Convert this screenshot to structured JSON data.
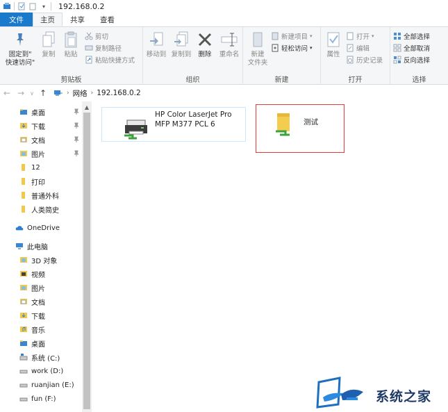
{
  "window": {
    "title": "192.168.0.2"
  },
  "tabs": [
    {
      "label": "文件"
    },
    {
      "label": "主页"
    },
    {
      "label": "共享"
    },
    {
      "label": "查看"
    }
  ],
  "ribbon": {
    "clipboard": {
      "label": "剪贴板",
      "pin_quick_access": "固定到\"\n快速访问\"",
      "pin_line1": "固定到\"",
      "pin_line2": "快速访问\"",
      "copy": "复制",
      "paste": "粘贴",
      "cut": "剪切",
      "copy_path": "复制路径",
      "paste_shortcut": "粘贴快捷方式"
    },
    "organize": {
      "label": "组织",
      "move_to": "移动到",
      "copy_to": "复制到",
      "delete": "删除",
      "rename": "重命名"
    },
    "new": {
      "label": "新建",
      "new_folder_line1": "新建",
      "new_folder_line2": "文件夹",
      "new_item": "新建项目",
      "easy_access": "轻松访问"
    },
    "open": {
      "label": "打开",
      "properties": "属性",
      "open": "打开",
      "edit": "编辑",
      "history": "历史记录"
    },
    "select": {
      "label": "选择",
      "select_all": "全部选择",
      "select_none": "全部取消",
      "invert": "反向选择"
    }
  },
  "address": {
    "root": "网络",
    "host": "192.168.0.2"
  },
  "nav": {
    "quick_access": [
      {
        "label": "桌面",
        "icon": "desktop-folder-icon",
        "pinned": true
      },
      {
        "label": "下载",
        "icon": "download-folder-icon",
        "pinned": true
      },
      {
        "label": "文档",
        "icon": "documents-folder-icon",
        "pinned": true
      },
      {
        "label": "图片",
        "icon": "pictures-folder-icon",
        "pinned": true
      },
      {
        "label": "12",
        "icon": "folder-icon",
        "pinned": false
      },
      {
        "label": "打印",
        "icon": "folder-icon",
        "pinned": false
      },
      {
        "label": "普通外科",
        "icon": "folder-icon",
        "pinned": false
      },
      {
        "label": "人类简史",
        "icon": "folder-icon",
        "pinned": false
      }
    ],
    "onedrive": "OneDrive",
    "this_pc": "此电脑",
    "pc_items": [
      {
        "label": "3D 对象",
        "icon": "3d-objects-icon"
      },
      {
        "label": "视频",
        "icon": "videos-folder-icon"
      },
      {
        "label": "图片",
        "icon": "pictures-folder-icon"
      },
      {
        "label": "文档",
        "icon": "documents-folder-icon"
      },
      {
        "label": "下载",
        "icon": "download-folder-icon"
      },
      {
        "label": "音乐",
        "icon": "music-folder-icon"
      },
      {
        "label": "桌面",
        "icon": "desktop-folder-icon"
      },
      {
        "label": "系统 (C:)",
        "icon": "system-drive-icon"
      },
      {
        "label": "work (D:)",
        "icon": "drive-icon"
      },
      {
        "label": "ruanjian (E:)",
        "icon": "drive-icon"
      },
      {
        "label": "fun (F:)",
        "icon": "drive-icon"
      }
    ]
  },
  "content": {
    "printer": {
      "line1": "HP Color LaserJet Pro",
      "line2": "MFP M377 PCL 6"
    },
    "share": {
      "name": "测试"
    }
  },
  "watermark": {
    "text": "系统之家"
  },
  "colors": {
    "file_tab": "#1979ca",
    "highlight_border": "#e53a3a",
    "ribbon_bg": "#f5f6f7"
  }
}
